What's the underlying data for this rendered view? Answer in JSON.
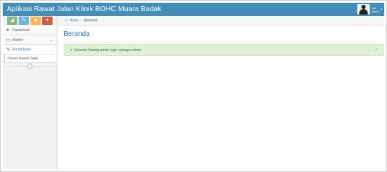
{
  "navbar": {
    "brand": "Aplikasi Rawat Jalan Klinik BOHC Muara Badak",
    "user_greeting": "Hai,",
    "user_name": "admin"
  },
  "sidebar": {
    "shortcuts": [
      {
        "icon": "signal-icon",
        "color": "#87b87f",
        "glyph": "◢"
      },
      {
        "icon": "pencil-icon",
        "color": "#6fb3e0",
        "glyph": "✎"
      },
      {
        "icon": "users-icon",
        "color": "#ffb752",
        "glyph": "☻"
      },
      {
        "icon": "cogs-icon",
        "color": "#d15b47",
        "glyph": "✦"
      }
    ],
    "items": [
      {
        "label": "Dashboard",
        "icon": "tachometer-icon"
      },
      {
        "label": "Master",
        "icon": "desktop-icon"
      },
      {
        "label": "Pendaftaran",
        "icon": "edit-icon"
      }
    ],
    "subitems": [
      {
        "label": "Pasien Rawat Jalan"
      }
    ]
  },
  "breadcrumbs": {
    "home": "Home",
    "current": "Beranda"
  },
  "page": {
    "title": "Beranda"
  },
  "alert": {
    "message": "Selamat Datang admin login sebagai admin",
    "close": "×"
  }
}
